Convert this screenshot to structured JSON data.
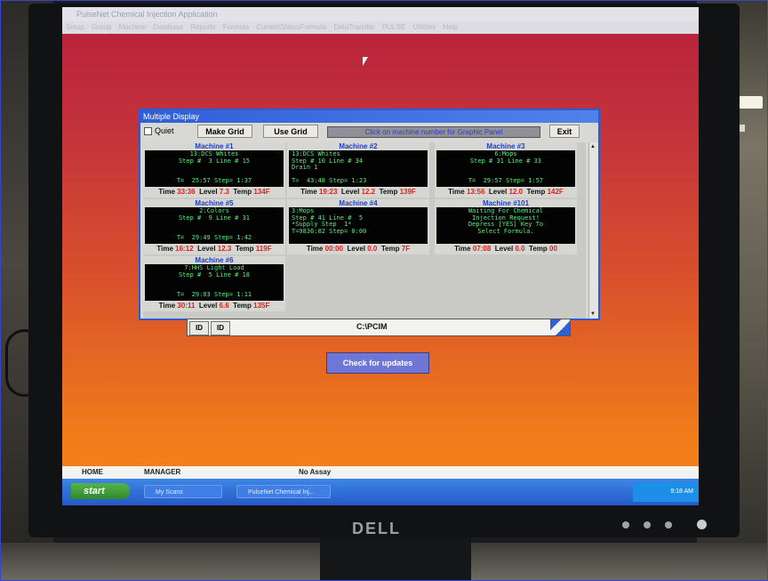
{
  "app": {
    "title": "PulseNet Chemical Injection Application",
    "menu": [
      "Setup",
      "Group",
      "Machine",
      "Database",
      "Reports",
      "Formula",
      "CurrentStatusFormula",
      "DataTransfer",
      "PULSE",
      "Utilities",
      "Help"
    ]
  },
  "multiple_display": {
    "title": "Multiple Display",
    "quiet_label": "Quiet",
    "make_grid_label": "Make Grid",
    "use_grid_label": "Use Grid",
    "banner": "Click on machine number for Graphic Panel",
    "exit_label": "Exit",
    "machines": [
      {
        "name": "Machine #1",
        "screen": "13:DCS Whites\nStep #  3 Line # 15\n\n\nT=  25:57 Step= 1:37",
        "time": "33:36",
        "level": "7.3",
        "temp": "134F"
      },
      {
        "name": "Machine #2",
        "screen": "13:DCS Whites\nStep # 10 Line # 34\nDrain 1\n\nT=  43:48 Step= 1:23",
        "time": "19:23",
        "level": "12.2",
        "temp": "139F"
      },
      {
        "name": "Machine #3",
        "screen": "6:Mops\nStep # 31 Line # 33\n\n\nT=  29:57 Step= 1:57",
        "time": "13:56",
        "level": "12.0",
        "temp": "142F"
      },
      {
        "name": "Machine #5",
        "screen": "2:Colors\nStep #  9 Line # 31\n\n\nT=  29:49 Step= 1:42",
        "time": "16:12",
        "level": "12.3",
        "temp": "119F"
      },
      {
        "name": "Machine #4",
        "screen": "3:Mops\nStep # 41 Line #  5\n*Supply Step  1*\nT=9836:02 Step= 0:00",
        "time": "00:00",
        "level": "0.0",
        "temp": "7F"
      },
      {
        "name": "Machine #101",
        "screen": "Waiting For Chemical\nInjection Request!\nDepress [YES] Key To\nSelect Formula.",
        "time": "07:08",
        "level": "0.0",
        "temp": "00"
      },
      {
        "name": "Machine #6",
        "screen": "7:HHS Light Load\nStep #  5 Line # 18\n\n\nT=  29:03 Step= 1:11",
        "time": "30:11",
        "level": "6.6",
        "temp": "135F"
      }
    ],
    "labels": {
      "time": "Time",
      "level": "Level",
      "temp": "Temp"
    }
  },
  "main_window": {
    "id_label_1": "ID",
    "id_label_2": "ID",
    "path": "C:\\PCIM"
  },
  "check_updates_label": "Check for updates",
  "status_bar": {
    "left": "HOME",
    "middle": "MANAGER",
    "right": "No Assay"
  },
  "taskbar": {
    "start_label": "start",
    "tasks": [
      "My Scans",
      "PulseNet Chemical Inj..."
    ],
    "clock": "9:18 AM"
  },
  "monitor_brand": "DELL"
}
